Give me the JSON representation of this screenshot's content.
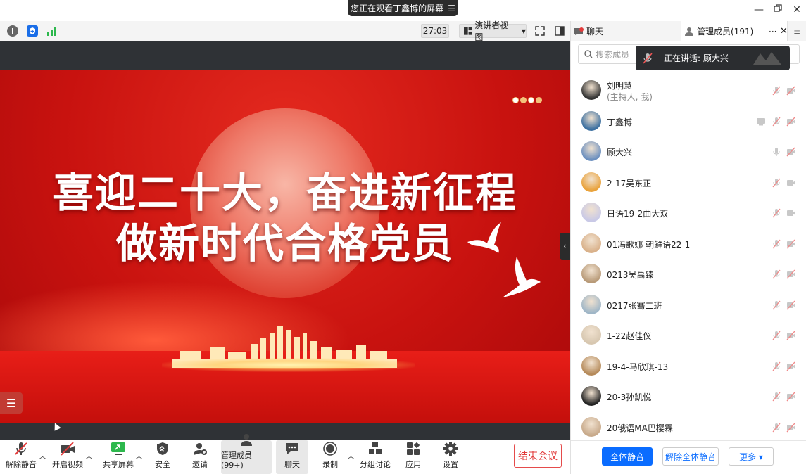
{
  "window": {
    "share_banner": "您正在观看丁鑫博的屏幕"
  },
  "toolbar": {
    "timer": "27:03",
    "view_label": "演讲者视图"
  },
  "slide": {
    "line1": "喜迎二十大，奋进新征程",
    "line2": "做新时代合格党员"
  },
  "bottom_bar": {
    "unmute": "解除静音",
    "start_video": "开启视频",
    "share_screen": "共享屏幕",
    "security": "安全",
    "invite": "邀请",
    "manage_members": "管理成员(99+)",
    "chat": "聊天",
    "record": "录制",
    "breakout": "分组讨论",
    "apps": "应用",
    "settings": "设置",
    "end_meeting": "结束会议"
  },
  "panel": {
    "tab_chat": "聊天",
    "tab_members": "管理成员(191)",
    "search_placeholder": "搜索成员",
    "speaking_toast": "正在讲话: 顾大兴",
    "members": [
      {
        "name": "刘明慧",
        "sub": "(主持人, 我)"
      },
      {
        "name": "丁鑫博"
      },
      {
        "name": "顾大兴"
      },
      {
        "name": "2-17吴东正"
      },
      {
        "name": "日语19-2曲大双"
      },
      {
        "name": "01冯歌娜 朝鲜语22-1"
      },
      {
        "name": "0213吴禹臻"
      },
      {
        "name": "0217张骞二班"
      },
      {
        "name": "1-22赵佳仪"
      },
      {
        "name": "19-4-马欣琪-13"
      },
      {
        "name": "20-3孙凯悦"
      },
      {
        "name": "20俄语MA巴樱霖"
      }
    ],
    "mute_all": "全体静音",
    "unmute_all": "解除全体静音",
    "more": "更多 ▾"
  },
  "colors": {
    "accent_blue": "#0a6cff",
    "end_red": "#e23b3b",
    "slide_red": "#c8120f"
  }
}
